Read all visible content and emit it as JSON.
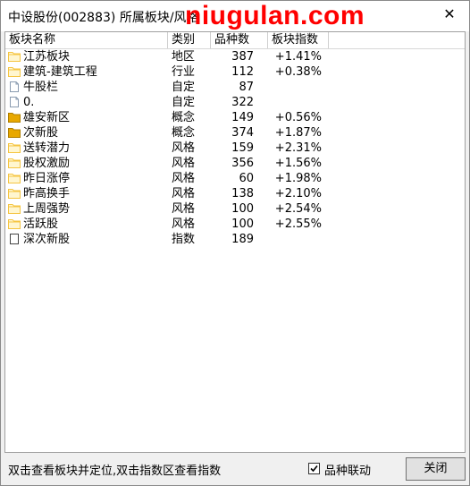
{
  "window": {
    "title": "中设股份(002883)",
    "title_suffix": "所属板块/风格",
    "watermark": "niugulan.com",
    "close_glyph": "✕"
  },
  "table": {
    "headers": [
      "板块名称",
      "类别",
      "品种数",
      "板块指数"
    ],
    "rows": [
      {
        "name": "江苏板块",
        "icon": "folder-icon",
        "type": "地区",
        "count": "387",
        "index": "+1.41%"
      },
      {
        "name": "建筑-建筑工程",
        "icon": "folder-icon",
        "type": "行业",
        "count": "112",
        "index": "+0.38%"
      },
      {
        "name": "牛股栏",
        "icon": "document-icon",
        "type": "自定",
        "count": "87",
        "index": ""
      },
      {
        "name": "0.",
        "icon": "document-icon",
        "type": "自定",
        "count": "322",
        "index": ""
      },
      {
        "name": "雄安新区",
        "icon": "folder-filled-icon",
        "type": "概念",
        "count": "149",
        "index": "+0.56%"
      },
      {
        "name": "次新股",
        "icon": "folder-filled-icon",
        "type": "概念",
        "count": "374",
        "index": "+1.87%"
      },
      {
        "name": "送转潜力",
        "icon": "folder-icon",
        "type": "风格",
        "count": "159",
        "index": "+2.31%"
      },
      {
        "name": "股权激励",
        "icon": "folder-icon",
        "type": "风格",
        "count": "356",
        "index": "+1.56%"
      },
      {
        "name": "昨日涨停",
        "icon": "folder-icon",
        "type": "风格",
        "count": "60",
        "index": "+1.98%"
      },
      {
        "name": "昨高换手",
        "icon": "folder-icon",
        "type": "风格",
        "count": "138",
        "index": "+2.10%"
      },
      {
        "name": "上周强势",
        "icon": "folder-icon",
        "type": "风格",
        "count": "100",
        "index": "+2.54%"
      },
      {
        "name": "活跃股",
        "icon": "folder-icon",
        "type": "风格",
        "count": "100",
        "index": "+2.55%"
      },
      {
        "name": "深次新股",
        "icon": "index-page-icon",
        "type": "指数",
        "count": "189",
        "index": ""
      }
    ]
  },
  "footer": {
    "hint": "双击查看板块并定位,双击指数区查看指数",
    "checkbox_label": "品种联动",
    "checkbox_checked": true,
    "close_button": "关闭"
  },
  "colors": {
    "watermark": "#ff0000",
    "folder": "#f5c542",
    "folder_filled": "#e8a800"
  }
}
